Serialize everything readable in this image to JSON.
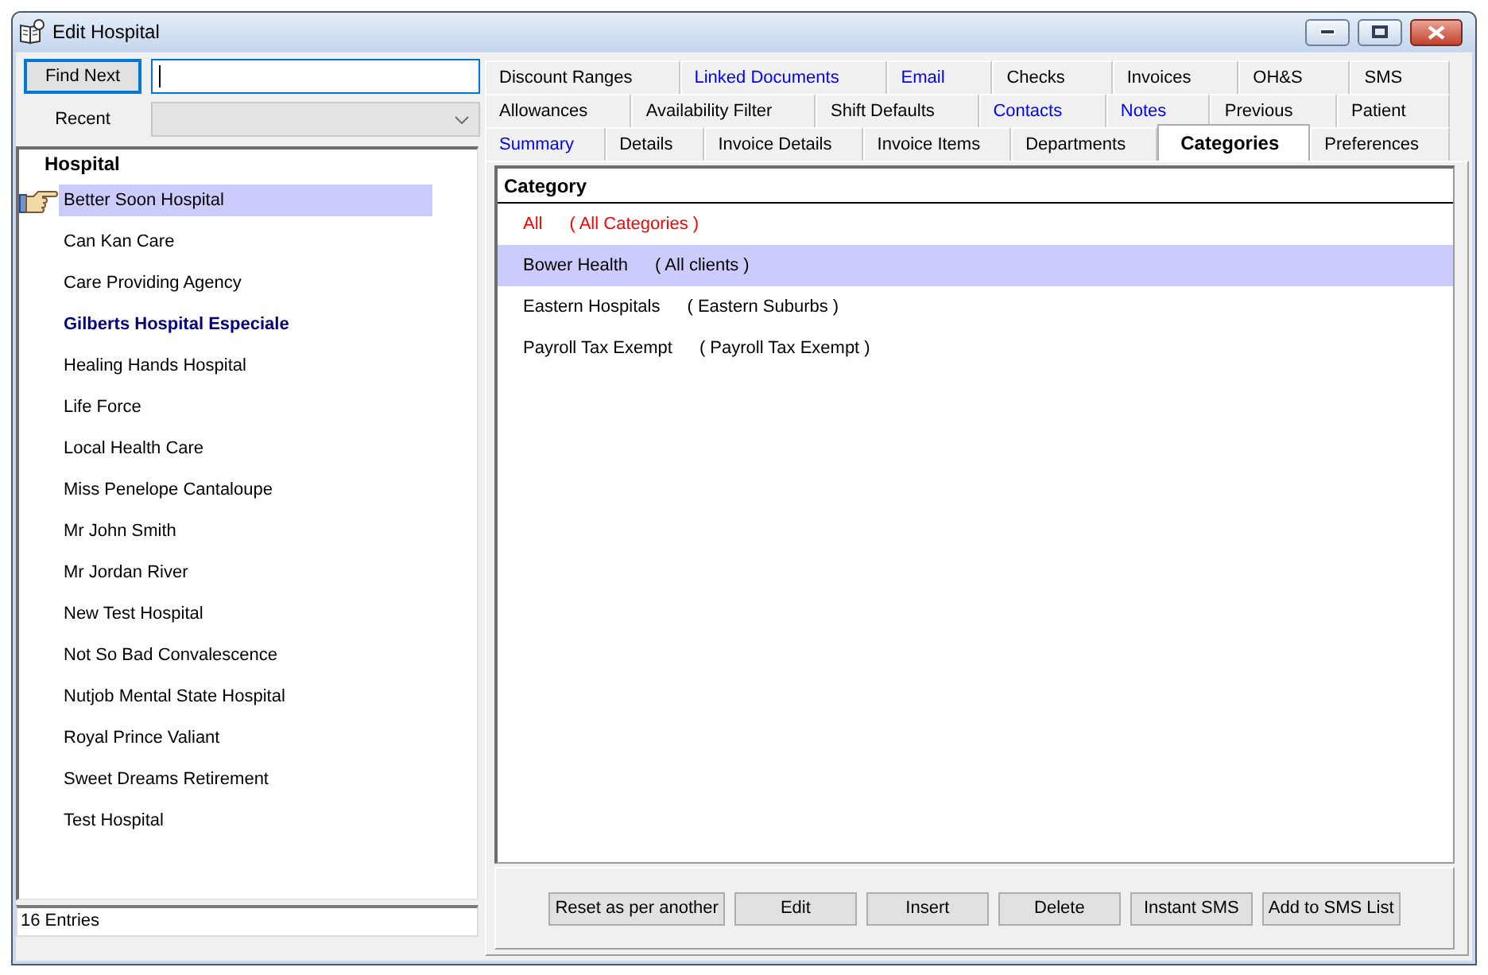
{
  "window": {
    "title": "Edit Hospital"
  },
  "search": {
    "button": "Find Next"
  },
  "recent": {
    "label": "Recent",
    "disabled": true
  },
  "hospital_list": {
    "header": "Hospital",
    "items": [
      {
        "label": "Better Soon Hospital",
        "selected": true,
        "emphasized": false
      },
      {
        "label": "Can Kan Care",
        "selected": false,
        "emphasized": false
      },
      {
        "label": "Care Providing Agency",
        "selected": false,
        "emphasized": false
      },
      {
        "label": "Gilberts Hospital Especiale",
        "selected": false,
        "emphasized": true
      },
      {
        "label": "Healing Hands Hospital",
        "selected": false,
        "emphasized": false
      },
      {
        "label": "Life Force",
        "selected": false,
        "emphasized": false
      },
      {
        "label": "Local Health Care",
        "selected": false,
        "emphasized": false
      },
      {
        "label": "Miss Penelope Cantaloupe",
        "selected": false,
        "emphasized": false
      },
      {
        "label": "Mr John Smith",
        "selected": false,
        "emphasized": false
      },
      {
        "label": "Mr Jordan River",
        "selected": false,
        "emphasized": false
      },
      {
        "label": "New Test Hospital",
        "selected": false,
        "emphasized": false
      },
      {
        "label": "Not So Bad Convalescence",
        "selected": false,
        "emphasized": false
      },
      {
        "label": "Nutjob Mental State Hospital",
        "selected": false,
        "emphasized": false
      },
      {
        "label": "Royal Prince Valiant",
        "selected": false,
        "emphasized": false
      },
      {
        "label": "Sweet Dreams Retirement",
        "selected": false,
        "emphasized": false
      },
      {
        "label": "Test Hospital",
        "selected": false,
        "emphasized": false
      }
    ],
    "status": "16 Entries"
  },
  "tab_rows": [
    [
      {
        "label": "Discount Ranges",
        "selected": false,
        "highlighted": false
      },
      {
        "label": "Linked Documents",
        "selected": false,
        "highlighted": true
      },
      {
        "label": "Email",
        "selected": false,
        "highlighted": true
      },
      {
        "label": "Checks",
        "selected": false,
        "highlighted": false
      },
      {
        "label": "Invoices",
        "selected": false,
        "highlighted": false
      },
      {
        "label": "OH&S",
        "selected": false,
        "highlighted": false
      },
      {
        "label": "SMS",
        "selected": false,
        "highlighted": false
      }
    ],
    [
      {
        "label": "Allowances",
        "selected": false,
        "highlighted": false
      },
      {
        "label": "Availability Filter",
        "selected": false,
        "highlighted": false
      },
      {
        "label": "Shift Defaults",
        "selected": false,
        "highlighted": false
      },
      {
        "label": "Contacts",
        "selected": false,
        "highlighted": true
      },
      {
        "label": "Notes",
        "selected": false,
        "highlighted": true
      },
      {
        "label": "Previous",
        "selected": false,
        "highlighted": false
      },
      {
        "label": "Patient",
        "selected": false,
        "highlighted": false
      }
    ],
    [
      {
        "label": "Summary",
        "selected": false,
        "highlighted": true
      },
      {
        "label": "Details",
        "selected": false,
        "highlighted": false
      },
      {
        "label": "Invoice Details",
        "selected": false,
        "highlighted": false
      },
      {
        "label": "Invoice Items",
        "selected": false,
        "highlighted": false
      },
      {
        "label": "Departments",
        "selected": false,
        "highlighted": false
      },
      {
        "label": "Categories",
        "selected": true,
        "highlighted": false
      },
      {
        "label": "Preferences",
        "selected": false,
        "highlighted": false
      }
    ]
  ],
  "categories": {
    "header": "Category",
    "rows": [
      {
        "kind": "all",
        "name": "All",
        "description": "( All Categories )",
        "selected": false
      },
      {
        "kind": "item",
        "name": "Bower Health",
        "description": "( All clients )",
        "selected": true
      },
      {
        "kind": "item",
        "name": "Eastern Hospitals",
        "description": "( Eastern Suburbs )",
        "selected": false
      },
      {
        "kind": "item",
        "name": "Payroll Tax Exempt",
        "description": "( Payroll Tax Exempt )",
        "selected": false
      }
    ]
  },
  "buttons": [
    "Reset as per another",
    "Edit",
    "Insert",
    "Delete",
    "Instant SMS",
    "Add to SMS List"
  ]
}
